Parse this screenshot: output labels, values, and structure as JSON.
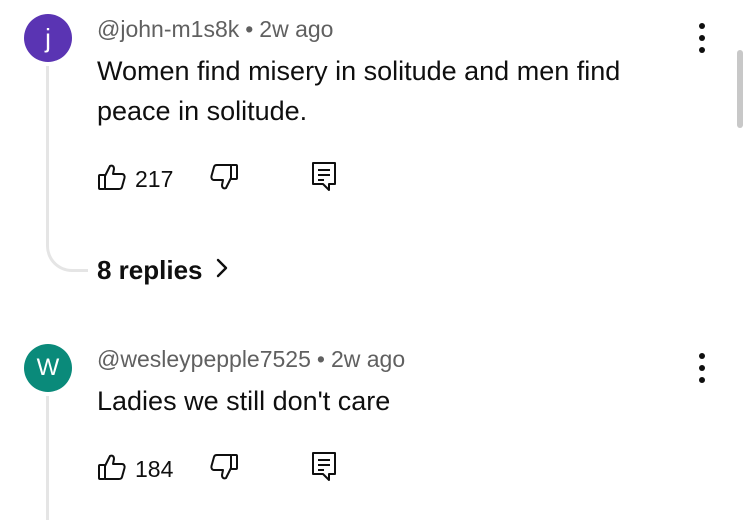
{
  "comments": [
    {
      "avatar_letter": "j",
      "avatar_color": "#5a34b3",
      "username": "@john-m1s8k",
      "separator": "•",
      "time": "2w ago",
      "text": "Women find misery in solitude and men find peace in solitude.",
      "likes": "217",
      "replies_label": "8 replies"
    },
    {
      "avatar_letter": "W",
      "avatar_color": "#0a8a7a",
      "username": "@wesleypepple7525",
      "separator": "•",
      "time": "2w ago",
      "text": "Ladies we still don't care",
      "likes": "184"
    }
  ],
  "icons": {
    "like": "thumb-up-icon",
    "dislike": "thumb-down-icon",
    "reply": "reply-icon",
    "more": "more-vertical-icon",
    "chevron": "chevron-right-icon"
  }
}
